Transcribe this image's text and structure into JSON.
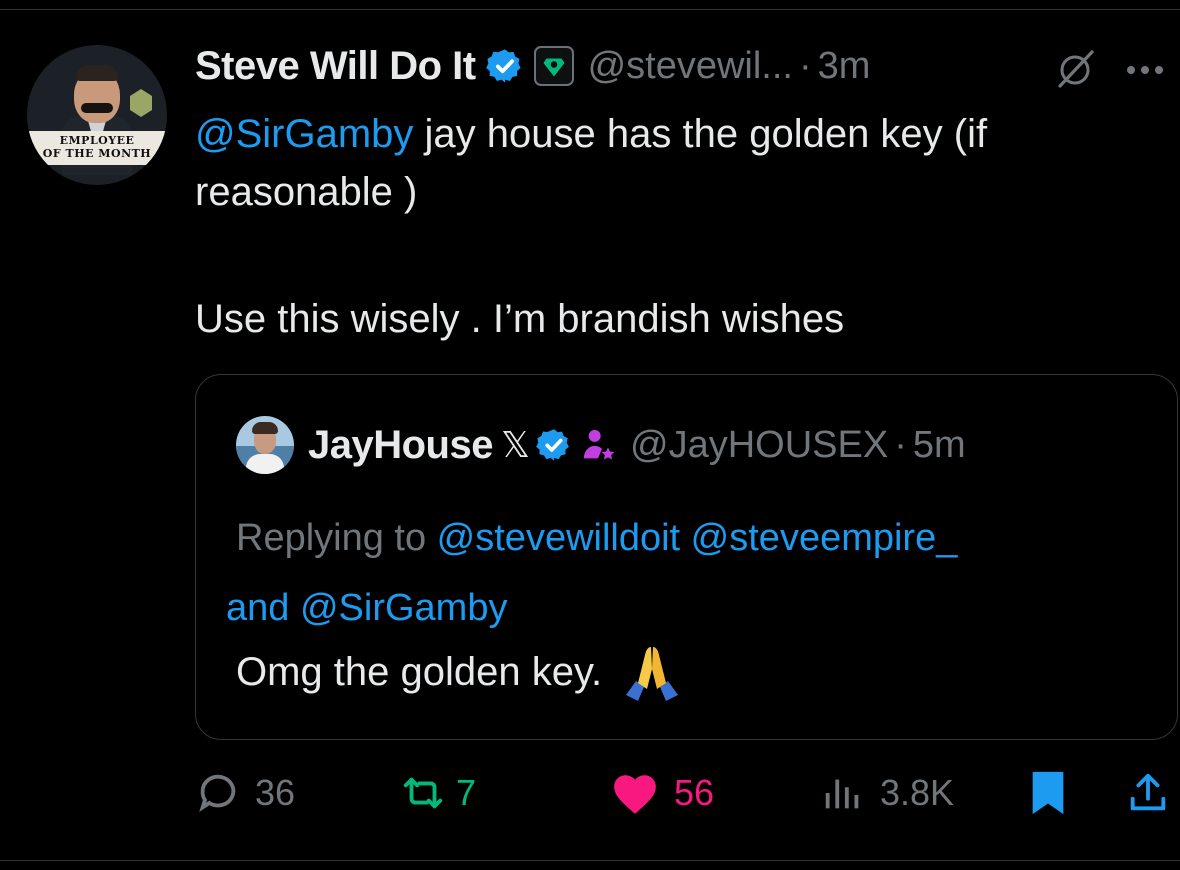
{
  "tweet": {
    "author_name": "Steve Will Do It",
    "handle": "@stevewil...",
    "separator": "·",
    "time": "3m",
    "avatar_plaque_line1": "EMPLOYEE",
    "avatar_plaque_line2": "OF THE MONTH",
    "mention": "@SirGamby",
    "text_line1_rest": " jay house has the golden key (if reasonable )",
    "text_paragraph2": "Use this wisely . I’m brandish wishes"
  },
  "quote": {
    "author_name": "JayHouse",
    "x_glyph": "𝕏",
    "handle": "@JayHOUSEX",
    "separator": "·",
    "time": "5m",
    "replying_prefix": "Replying to ",
    "reply_mention1": "@stevewilldoit",
    "reply_space": " ",
    "reply_mention2": "@steveempire_",
    "reply_and": " and ",
    "reply_mention3": "@SirGamby",
    "text": "Omg the golden key."
  },
  "actions": {
    "replies": "36",
    "reposts": "7",
    "likes": "56",
    "views": "3.8K"
  },
  "colors": {
    "background": "#000000",
    "text": "#e7e9ea",
    "muted": "#71767b",
    "link": "#1d9bf0",
    "repost": "#00ba7c",
    "like": "#f91880",
    "verified": "#1d9bf0",
    "affiliate_badge": "#00ba7c",
    "person_icon": "#c13ee0"
  },
  "icons": [
    "verified-badge-icon",
    "affiliate-badge-icon",
    "grok-icon",
    "more-icon",
    "x-logo-icon",
    "person-star-icon",
    "praying-hands-emoji",
    "reply-icon",
    "repost-icon",
    "heart-icon",
    "views-icon",
    "bookmark-icon",
    "share-icon"
  ]
}
